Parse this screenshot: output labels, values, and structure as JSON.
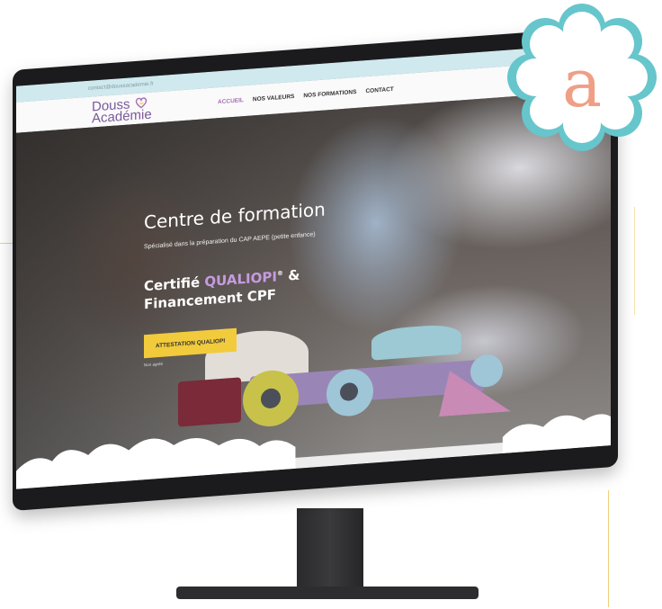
{
  "browser": {
    "top_contact": "contact@doussacademie.fr"
  },
  "header": {
    "logo": {
      "line1": "Douss",
      "line2": "Académie"
    },
    "nav": [
      {
        "label": "ACCUEIL",
        "active": true
      },
      {
        "label": "NOS VALEURS",
        "active": false
      },
      {
        "label": "NOS FORMATIONS",
        "active": false
      },
      {
        "label": "CONTACT",
        "active": false
      }
    ]
  },
  "hero": {
    "title": "Centre de formation",
    "subtitle": "Spécialisé dans la préparation du CAP AEPE (petite enfance)",
    "cert_prefix": "Certifié",
    "cert_brand": "QUALIOPI",
    "cert_sup": "®",
    "cert_amp": "&",
    "cert_line2": "Financement CPF",
    "cta_label": "ATTESTATION QUALIOPI",
    "cta_note": "Non agréé"
  },
  "badge": {
    "letter": "a"
  },
  "colors": {
    "accent": "#a66fb5",
    "cta": "#f2cb3c",
    "topbar": "#cfe9ee",
    "badge_petals": "#66c6cc",
    "badge_letter": "#ef9f86"
  }
}
